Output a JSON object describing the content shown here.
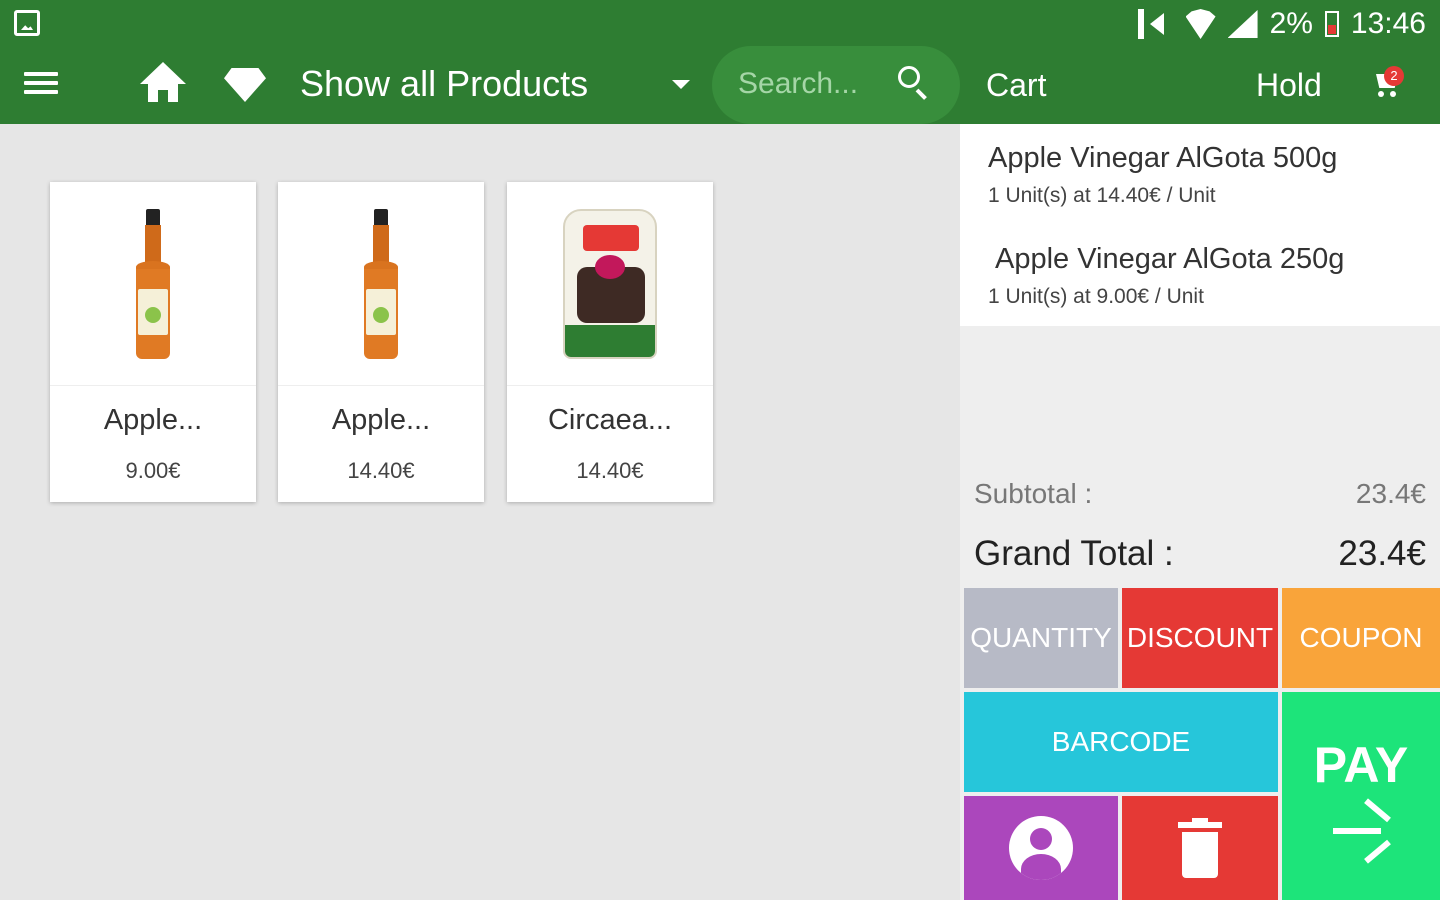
{
  "status_bar": {
    "battery": "2%",
    "time": "13:46"
  },
  "app_bar": {
    "title": "Show all Products",
    "search_placeholder": "Search...",
    "cart_title": "Cart",
    "hold_label": "Hold",
    "cart_badge": "2"
  },
  "products": [
    {
      "name": "Apple...",
      "price": "9.00€",
      "image": "vinegar-bottle"
    },
    {
      "name": "Apple...",
      "price": "14.40€",
      "image": "vinegar-bottle"
    },
    {
      "name": "Circaea...",
      "price": "14.40€",
      "image": "dried-fruit-package"
    }
  ],
  "cart": {
    "items": [
      {
        "name": "Apple Vinegar AlGota 500g",
        "detail": "1 Unit(s) at 14.40€ / Unit"
      },
      {
        "name": "Apple Vinegar AlGota 250g",
        "detail": "1 Unit(s) at 9.00€ / Unit"
      }
    ],
    "subtotal_label": "Subtotal :",
    "subtotal_value": "23.4€",
    "grand_total_label": "Grand Total :",
    "grand_total_value": "23.4€"
  },
  "actions": {
    "quantity": "QUANTITY",
    "discount": "DISCOUNT",
    "coupon": "COUPON",
    "barcode": "BARCODE",
    "pay": "PAY"
  },
  "colors": {
    "app_bar": "#2e7d32",
    "quantity": "#b7bac6",
    "discount": "#e53935",
    "coupon": "#f9a43a",
    "barcode": "#26c6da",
    "customer": "#ab47bc",
    "delete": "#e53935",
    "pay": "#1de47a"
  }
}
